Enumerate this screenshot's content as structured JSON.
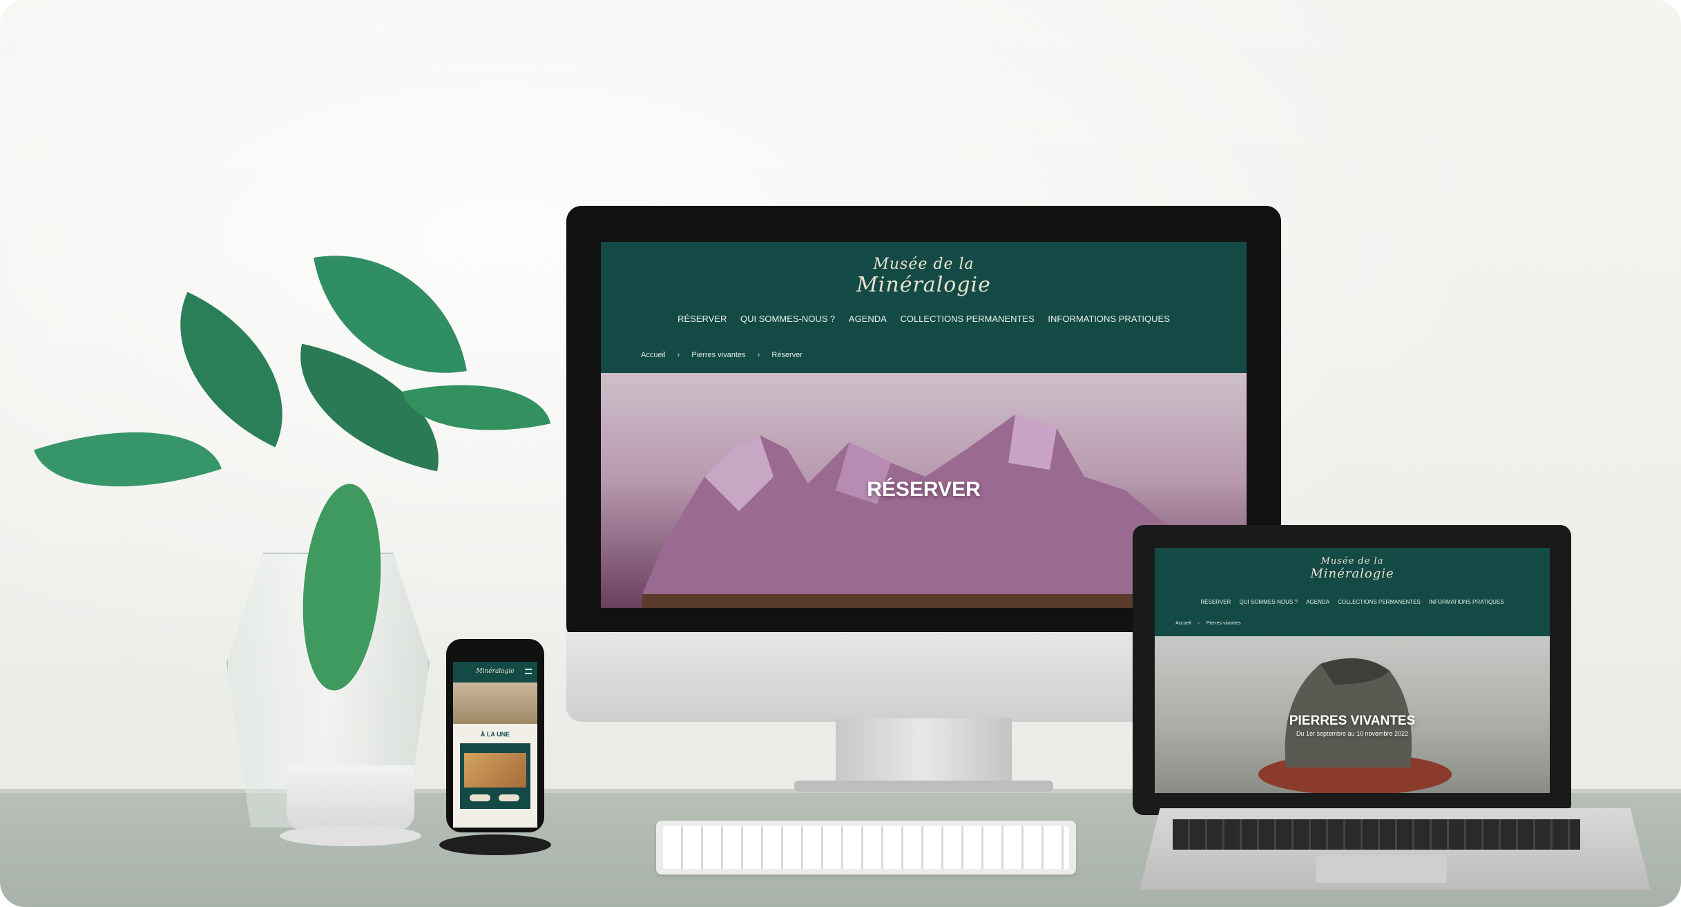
{
  "site": {
    "logo_line1": "Musée de la",
    "logo_line2": "Minéralogie",
    "nav": [
      "RÉSERVER",
      "QUI SOMMES-NOUS ?",
      "AGENDA",
      "COLLECTIONS PERMANENTES",
      "INFORMATIONS PRATIQUES"
    ]
  },
  "desktop": {
    "breadcrumb": [
      "Accueil",
      "Pierres vivantes",
      "Réserver"
    ],
    "hero_title": "RÉSERVER"
  },
  "laptop": {
    "breadcrumb": [
      "Accueil",
      "Pierres vivantes"
    ],
    "hero_title": "PIERRES VIVANTES",
    "hero_subtitle": "Du 1er septembre au 10 novembre 2022"
  },
  "phone": {
    "section_title": "À LA UNE"
  },
  "breadcrumb_separator": "›",
  "colors": {
    "header_green": "#144a46",
    "logo_cream": "#eae2cf",
    "amethyst": "#b89aaf"
  }
}
